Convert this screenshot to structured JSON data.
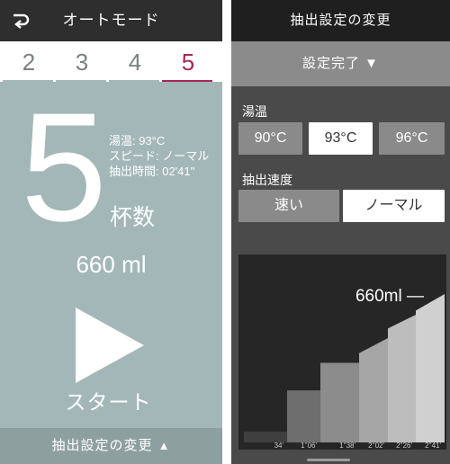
{
  "left": {
    "title": "オートモード",
    "cup_tabs": [
      "2",
      "3",
      "4",
      "5"
    ],
    "active_tab": 3,
    "selected_cups": "5",
    "info": {
      "temperature": "湯温: 93°C",
      "speed": "スピード: ノーマル",
      "time": "抽出時間: 02'41''"
    },
    "cups_label": "杯数",
    "volume": "660 ml",
    "start_label": "スタート",
    "footer_label": "抽出設定の変更",
    "footer_icon": "▲"
  },
  "right": {
    "title": "抽出設定の変更",
    "done_label": "設定完了",
    "done_icon": "▼",
    "temp_label": "湯温",
    "temp_options": [
      "90°C",
      "93°C",
      "96°C"
    ],
    "temp_selected": 1,
    "speed_label": "抽出速度",
    "speed_options": [
      "速い",
      "ノーマル"
    ],
    "speed_selected": 1
  },
  "chart_data": {
    "type": "area",
    "x_labels": [
      "34'",
      "1''06'",
      "1''38'",
      "2''02'",
      "2''26'",
      "2''41'"
    ],
    "steps": [
      {
        "label": "34'",
        "start_level": 0.0,
        "end_level": 0.0
      },
      {
        "label": "1''06'",
        "start_level": 0.3,
        "end_level": 0.3
      },
      {
        "label": "1''38'",
        "start_level": 0.5,
        "end_level": 0.5
      },
      {
        "label": "2''02'",
        "start_level": 0.57,
        "end_level": 0.68
      },
      {
        "label": "2''26'",
        "start_level": 0.75,
        "end_level": 0.85
      },
      {
        "label": "2''41'",
        "start_level": 0.88,
        "end_level": 1.0
      }
    ],
    "end_label": "660ml —",
    "colors": [
      "#3f3f3f",
      "#6e6e6e",
      "#8c8c8c",
      "#a6a6a6",
      "#bdbdbd",
      "#d0d0d0"
    ],
    "background": "#262626",
    "label_color": "#c8c8c8"
  },
  "colors": {
    "accent": "#a8275a",
    "left_bg": "#a3b7b8",
    "header_bg": "#2e2e2e"
  }
}
